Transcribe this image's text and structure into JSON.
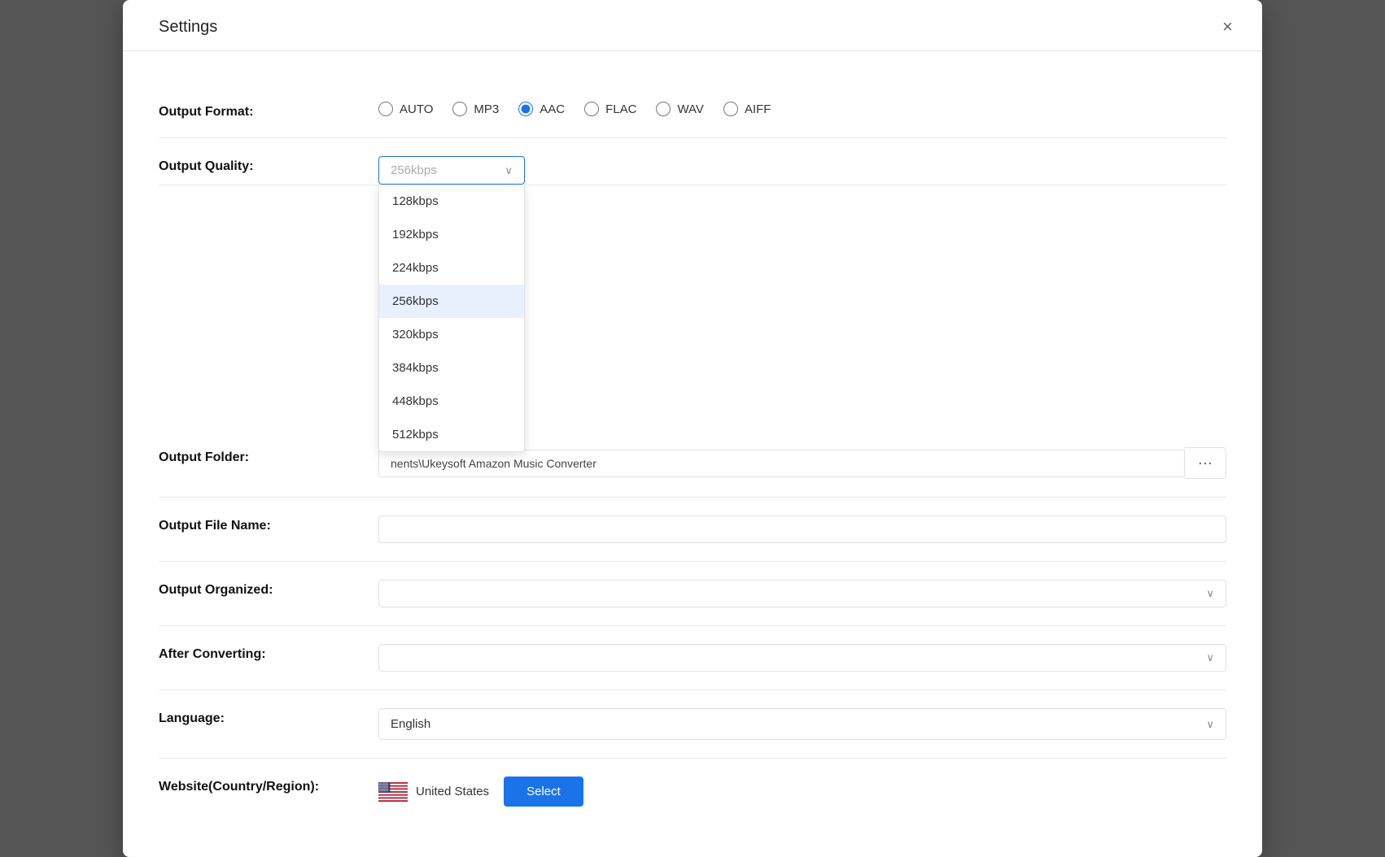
{
  "dialog": {
    "title": "Settings",
    "close_label": "×"
  },
  "output_format": {
    "label": "Output Format:",
    "options": [
      "AUTO",
      "MP3",
      "AAC",
      "FLAC",
      "WAV",
      "AIFF"
    ],
    "selected": "AAC"
  },
  "output_quality": {
    "label": "Output Quality:",
    "selected": "256kbps",
    "options": [
      "128kbps",
      "192kbps",
      "224kbps",
      "256kbps",
      "320kbps",
      "384kbps",
      "448kbps",
      "512kbps"
    ]
  },
  "output_folder": {
    "label": "Output Folder:",
    "path": "nents\\Ukeysoft Amazon Music Converter",
    "browse_label": "···"
  },
  "output_file_name": {
    "label": "Output File Name:",
    "value": ""
  },
  "output_organized": {
    "label": "Output Organized:",
    "value": "",
    "chevron": "∨"
  },
  "after_converting": {
    "label": "After Converting:",
    "value": "",
    "chevron": "∨"
  },
  "language": {
    "label": "Language:",
    "value": "English",
    "chevron": "∨"
  },
  "website": {
    "label": "Website(Country/Region):",
    "country": "United States",
    "select_label": "Select"
  }
}
